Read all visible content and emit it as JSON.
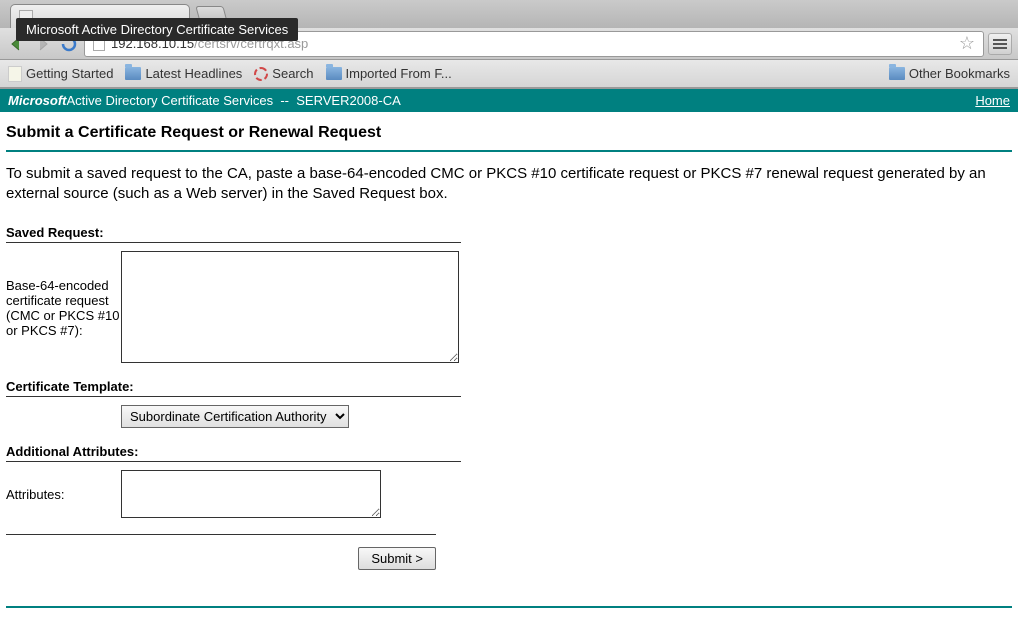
{
  "browser": {
    "tab_title": "Microsoft Active Directory Certificate Services",
    "url_host": "192.168.10.15",
    "url_path": "/certsrv/certrqxt.asp",
    "tooltip": "Microsoft Active Directory Certificate Services"
  },
  "bookmarks": {
    "getting_started": "Getting Started",
    "latest_headlines": "Latest Headlines",
    "search": "Search",
    "imported": "Imported From F...",
    "other": "Other Bookmarks"
  },
  "header": {
    "ms": "Microsoft",
    "adcs": " Active Directory Certificate Services",
    "sep": "  --  ",
    "server": "SERVER2008-CA",
    "home": "Home"
  },
  "page": {
    "title": "Submit a Certificate Request or Renewal Request",
    "description": "To submit a saved request to the CA, paste a base-64-encoded CMC or PKCS #10 certificate request or PKCS #7 renewal request generated by an external source (such as a Web server) in the Saved Request box."
  },
  "form": {
    "saved_request_label": "Saved Request:",
    "saved_request_field_label": "Base-64-encoded certificate request (CMC or PKCS #10 or PKCS #7):",
    "saved_request_value": "",
    "template_label": "Certificate Template:",
    "template_selected": "Subordinate Certification Authority",
    "attributes_label": "Additional Attributes:",
    "attributes_field_label": "Attributes:",
    "attributes_value": "",
    "submit_label": "Submit >"
  }
}
